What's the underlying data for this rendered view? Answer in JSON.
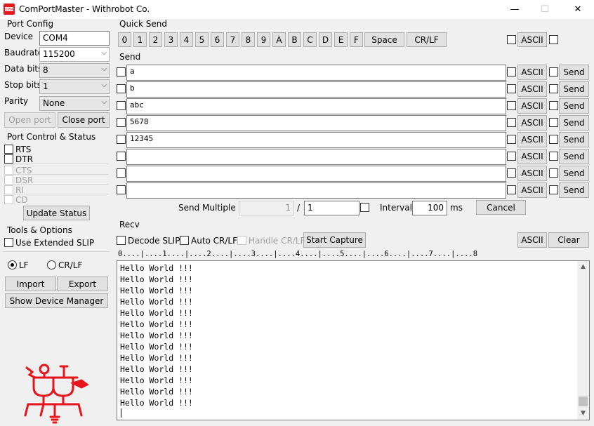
{
  "window": {
    "title": "ComPortMaster - Withrobot Co.",
    "minimize": "—",
    "maximize": "☐",
    "close": "✕"
  },
  "port_config": {
    "label": "Port Config",
    "device_label": "Device",
    "device_value": "COM4",
    "baudrate_label": "Baudrate",
    "baudrate_value": "115200",
    "databits_label": "Data bits",
    "databits_value": "8",
    "stopbits_label": "Stop bits",
    "stopbits_value": "1",
    "parity_label": "Parity",
    "parity_value": "None",
    "open_port": "Open port",
    "close_port": "Close port"
  },
  "port_control": {
    "label": "Port Control & Status",
    "rts": "RTS",
    "dtr": "DTR",
    "cts": "CTS",
    "dsr": "DSR",
    "ri": "RI",
    "cd": "CD",
    "update_status": "Update Status"
  },
  "tools": {
    "label": "Tools & Options",
    "use_extended_slip": "Use Extended SLIP",
    "lf": "LF",
    "crlf": "CR/LF",
    "import": "Import",
    "export": "Export",
    "show_device_manager": "Show Device Manager"
  },
  "quick_send": {
    "label": "Quick Send",
    "keys": [
      "0",
      "1",
      "2",
      "3",
      "4",
      "5",
      "6",
      "7",
      "8",
      "9",
      "A",
      "B",
      "C",
      "D",
      "E",
      "F"
    ],
    "space": "Space",
    "crlf": "CR/LF",
    "ascii": "ASCII"
  },
  "send": {
    "label": "Send",
    "rows": [
      "a",
      "b",
      "abc",
      "5678",
      "12345",
      "",
      "",
      ""
    ],
    "ascii_label": "ASCII",
    "send_label": "Send",
    "send_multiple_label": "Send Multiple :",
    "multiple_count": "1",
    "separator": "/",
    "multiple_total": "1",
    "interval_label": "Interval",
    "interval_value": "100",
    "interval_unit": "ms",
    "cancel": "Cancel"
  },
  "recv": {
    "label": "Recv",
    "decode_slip": "Decode SLIP",
    "auto_crlf": "Auto CR/LF",
    "handle_crlf": "Handle CR/LF",
    "start_capture": "Start Capture",
    "ascii": "ASCII",
    "clear": "Clear",
    "ruler": "0....|....1....|....2....|....3....|....4....|....5....|....6....|....7....|....8",
    "lines": [
      "Hello World !!!",
      "Hello World !!!",
      "Hello World !!!",
      "Hello World !!!",
      "Hello World !!!",
      "Hello World !!!",
      "Hello World !!!",
      "Hello World !!!",
      "Hello World !!!",
      "Hello World !!!",
      "Hello World !!!",
      "Hello World !!!",
      "Hello World !!!"
    ]
  },
  "colors": {
    "logo_red": "#e8141b",
    "window_bg": "#f0f0f0"
  }
}
